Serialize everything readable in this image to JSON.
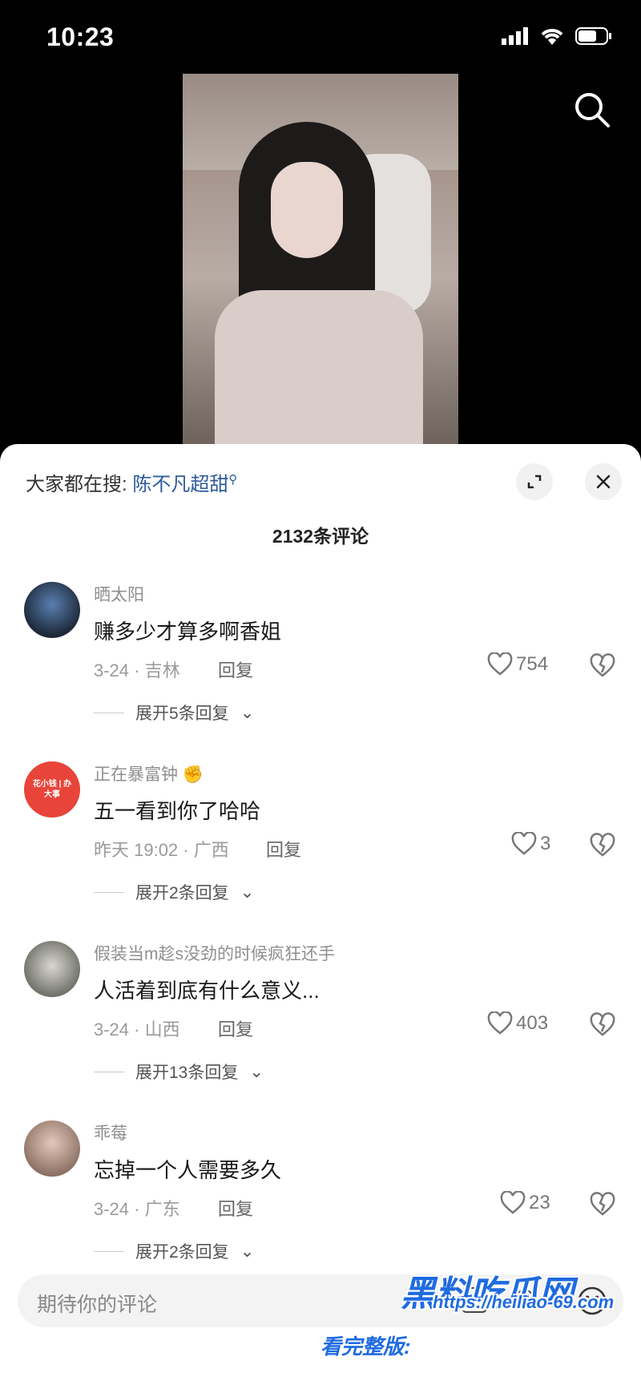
{
  "status_bar": {
    "time": "10:23"
  },
  "sheet": {
    "hot_search_prefix": "大家都在搜:",
    "hot_search_keyword": "陈不凡超甜",
    "comment_count": "2132条评论",
    "reply_label": "回复"
  },
  "comments": [
    {
      "username": "晒太阳",
      "text": "赚多少才算多啊香姐",
      "meta": "3-24 · 吉林",
      "likes": "754",
      "expand": "展开5条回复"
    },
    {
      "username": "正在暴富钟",
      "text": "五一看到你了哈哈",
      "meta": "昨天 19:02 · 广西",
      "likes": "3",
      "expand": "展开2条回复"
    },
    {
      "username": "假装当m趁s没劲的时候疯狂还手",
      "text": "人活着到底有什么意义...",
      "meta": "3-24 · 山西",
      "likes": "403",
      "expand": "展开13条回复"
    },
    {
      "username": "乖莓",
      "text": "忘掉一个人需要多久",
      "meta": "3-24 · 广东",
      "likes": "23",
      "expand": "展开2条回复"
    }
  ],
  "input": {
    "placeholder": "期待你的评论"
  },
  "avatar2_text": "花小钱 | 办大事",
  "watermark": {
    "brand": "黑料吃瓜网",
    "url": "https://heiliao-69.com",
    "note": "看完整版:"
  },
  "colors": {
    "accent": "#2d5b9a",
    "sheet_bg": "#ffffff",
    "watermark": "#1f6be0"
  }
}
